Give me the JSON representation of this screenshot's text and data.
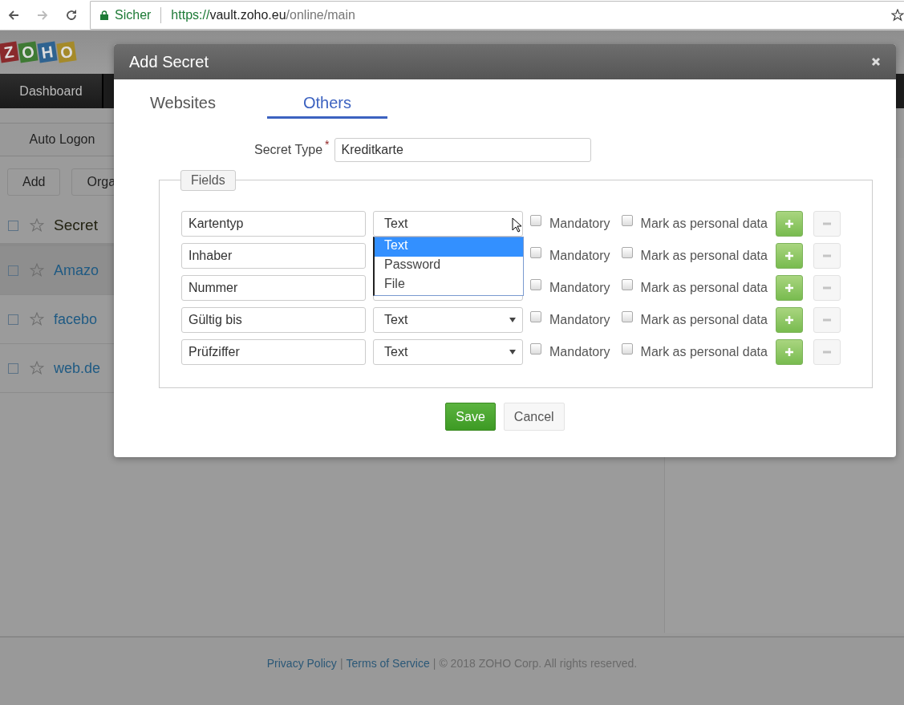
{
  "browser": {
    "security_label": "Sicher",
    "url": {
      "scheme": "https://",
      "host": "vault.zoho.eu",
      "path": "/online/main"
    }
  },
  "app": {
    "logo": [
      "Z",
      "O",
      "H",
      "O"
    ],
    "nav": [
      "Dashboard"
    ],
    "subnav": [
      "Auto Logon"
    ],
    "toolbar": [
      "Add",
      "Orga"
    ],
    "list": {
      "header": "Secret",
      "header_checked": false,
      "rows": [
        {
          "name": "Amazo",
          "selected": true,
          "checked": false
        },
        {
          "name": "facebo",
          "selected": false,
          "checked": false
        },
        {
          "name": "web.de",
          "selected": false,
          "checked": false
        }
      ]
    },
    "footer": [
      {
        "kind": "link",
        "text": "Privacy Policy"
      },
      {
        "kind": "sep",
        "text": "|"
      },
      {
        "kind": "link",
        "text": "Terms of Service"
      },
      {
        "kind": "sep",
        "text": "|"
      },
      {
        "kind": "text",
        "text": "© 2018 ZOHO Corp. All rights reserved."
      }
    ]
  },
  "dialog": {
    "title": "Add Secret",
    "tabs": [
      {
        "label": "Websites",
        "selected": false
      },
      {
        "label": "Others",
        "selected": true
      }
    ],
    "secret_type": {
      "label": "Secret Type",
      "required": "*",
      "value": "Kreditkarte"
    },
    "legend": "Fields",
    "fields": [
      {
        "name": "Kartentyp",
        "type": "Text",
        "open": true,
        "mandatory": false,
        "mandatory_label": "Mandatory",
        "personal": false,
        "personal_label": "Mark as personal data"
      },
      {
        "name": "Inhaber",
        "open": false,
        "mandatory": false,
        "mandatory_label": "Mandatory",
        "personal": false,
        "personal_label": "Mark as personal data"
      },
      {
        "name": "Nummer",
        "open": false,
        "mandatory": false,
        "mandatory_label": "Mandatory",
        "personal": false,
        "personal_label": "Mark as personal data"
      },
      {
        "name": "Gültig bis",
        "type": "Text",
        "open": false,
        "mandatory": false,
        "mandatory_label": "Mandatory",
        "personal": false,
        "personal_label": "Mark as personal data"
      },
      {
        "name": "Prüfziffer",
        "type": "Text",
        "open": false,
        "mandatory": false,
        "mandatory_label": "Mandatory",
        "personal": false,
        "personal_label": "Mark as personal data"
      }
    ],
    "type_options": [
      {
        "label": "Text",
        "selected": true
      },
      {
        "label": "Password",
        "selected": false
      },
      {
        "label": "File",
        "selected": false
      }
    ],
    "buttons": [
      {
        "label": "Save",
        "kind": "primary"
      },
      {
        "label": "Cancel",
        "kind": "secondary"
      }
    ]
  }
}
